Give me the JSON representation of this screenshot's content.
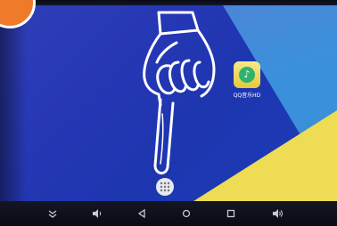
{
  "home_screen": {
    "app_icon": {
      "icon": "music-note-icon",
      "label": "QQ音乐HD"
    },
    "app_drawer": {
      "icon": "app-grid-icon"
    },
    "overlay": {
      "icon": "pointing-hand-icon"
    },
    "corner_badge": {
      "color": "#ee7a2a"
    }
  },
  "navbar": {
    "buttons": [
      {
        "icon": "chevron-collapse-icon"
      },
      {
        "icon": "volume-down-icon"
      },
      {
        "icon": "back-icon"
      },
      {
        "icon": "home-icon"
      },
      {
        "icon": "recents-icon"
      },
      {
        "icon": "volume-up-icon"
      }
    ]
  },
  "colors": {
    "wallpaper_blue": "#2637b4",
    "wallpaper_yellow": "#eddc54",
    "navbar": "#0a0b12"
  }
}
